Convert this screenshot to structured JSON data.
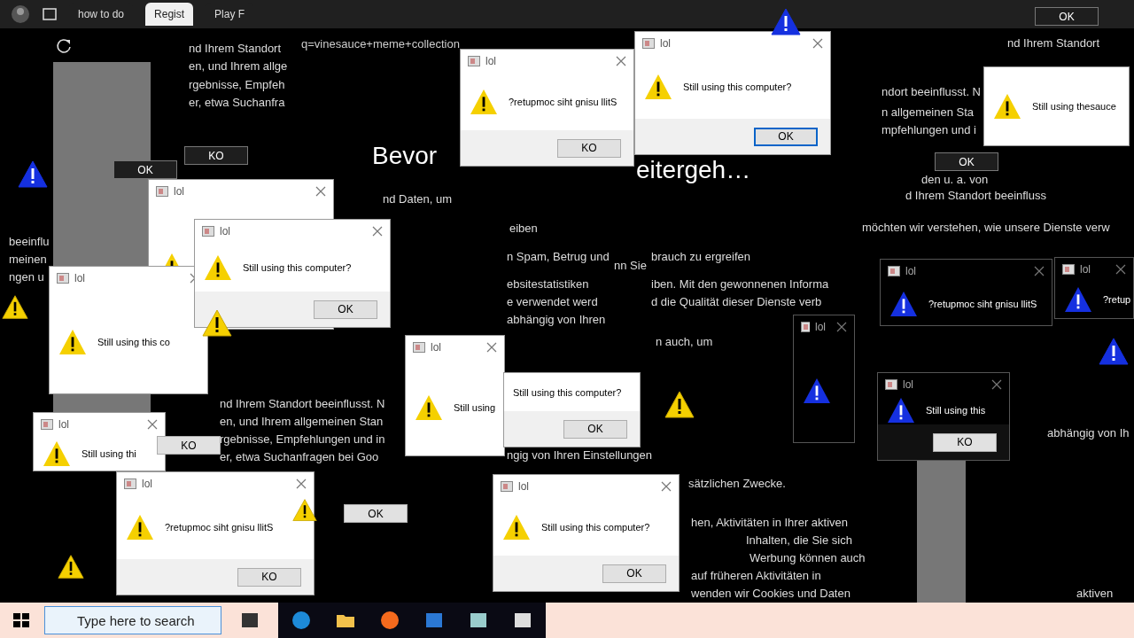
{
  "browser_tabs": [
    {
      "label": "how to do",
      "selected": false
    },
    {
      "label": "Regist",
      "selected": true
    },
    {
      "label": "Play F",
      "selected": false
    }
  ],
  "address_bar": {
    "value": "q=vinesauce+meme+collection"
  },
  "headings": [
    "Bevor",
    "eitergeh…"
  ],
  "page_texts": [
    "nd Ihrem Standort",
    "en, und Ihrem allge",
    "rgebnisse, Empfeh",
    "er, etwa Suchanfra",
    "nd Daten, um",
    "eiben",
    "n Spam, Betrug und",
    "ebsitestatistiken",
    "e verwendet werd",
    "abhängig von Ihren",
    "brauch zu ergreifen",
    "iben. Mit den gewonnenen Informa",
    "d die Qualität dieser Dienste verb",
    "n auch, um",
    "nn Sie",
    "ngig von Ihren Einstellungen",
    "sätzlichen Zwecke.",
    "hen, Aktivitäten in Ihrer aktiven",
    "Inhalten, die Sie sich",
    "Werbung können auch",
    "auf früheren Aktivitäten in",
    "wenden wir Cookies und Daten",
    "nd Ihrem Standort beeinflusst. N",
    "en, und Ihrem allgemeinen Stan",
    "rgebnisse, Empfehlungen und in",
    "er, etwa Suchanfragen bei Goo",
    "nd Ihrem Standort",
    "ndort beeinflusst. N",
    "n allgemeinen Sta",
    "mpfehlungen und i",
    "den u. a. von",
    "d Ihrem Standort beeinfluss",
    "möchten wir verstehen, wie unsere Dienste verw",
    "beeinflu",
    "meinen",
    "ngen u",
    "abhängig von Ih",
    "aktiven"
  ],
  "dialogs": [
    {
      "kind": "light",
      "title": "lol"
    },
    {
      "kind": "light",
      "title": "lol",
      "message": "Still using this co"
    },
    {
      "kind": "light",
      "title": "lol",
      "message": "Still using this computer?",
      "button": {
        "label": "OK",
        "focused": false
      }
    },
    {
      "kind": "light",
      "title": "lol",
      "message": "Still using"
    },
    {
      "kind": "light",
      "title": "lol",
      "message": "Still using thi"
    },
    {
      "kind": "light",
      "title": "lol",
      "message": "?retupmoc siht gnisu llitS",
      "button": {
        "label": "KO",
        "focused": false
      }
    },
    {
      "kind": "plain",
      "message": "Still using this computer?",
      "button": {
        "label": "OK",
        "focused": false
      }
    },
    {
      "kind": "light",
      "title": "lol",
      "message": "Still using this computer?",
      "button": {
        "label": "OK",
        "focused": false
      }
    },
    {
      "kind": "light",
      "title": "lol",
      "message": "?retupmoc siht gnisu llitS",
      "button": {
        "label": "KO",
        "focused": false
      }
    },
    {
      "kind": "light",
      "title": "lol",
      "message": "Still using this computer?",
      "button": {
        "label": "OK",
        "focused": true
      }
    },
    {
      "kind": "dark",
      "title": "lol"
    },
    {
      "kind": "dark",
      "title": "lol",
      "message": "?retupmoc siht gnisu llitS"
    },
    {
      "kind": "dark",
      "title": "lol",
      "message": "Still using this",
      "button": {
        "label": "KO",
        "focused": false
      }
    },
    {
      "kind": "light",
      "message": "Still using thesauce"
    },
    {
      "kind": "dark",
      "title": "lol",
      "message": "?retup"
    }
  ],
  "loose_buttons": [
    {
      "label": "OK",
      "kind": "dark"
    },
    {
      "label": "OK",
      "kind": "dark"
    },
    {
      "label": "OK",
      "kind": "dark"
    },
    {
      "label": "KO",
      "kind": "dark"
    },
    {
      "label": "KO",
      "kind": "light"
    },
    {
      "label": "OK",
      "kind": "light"
    }
  ],
  "taskbar": {
    "search": {
      "placeholder": "Type here to search"
    }
  }
}
